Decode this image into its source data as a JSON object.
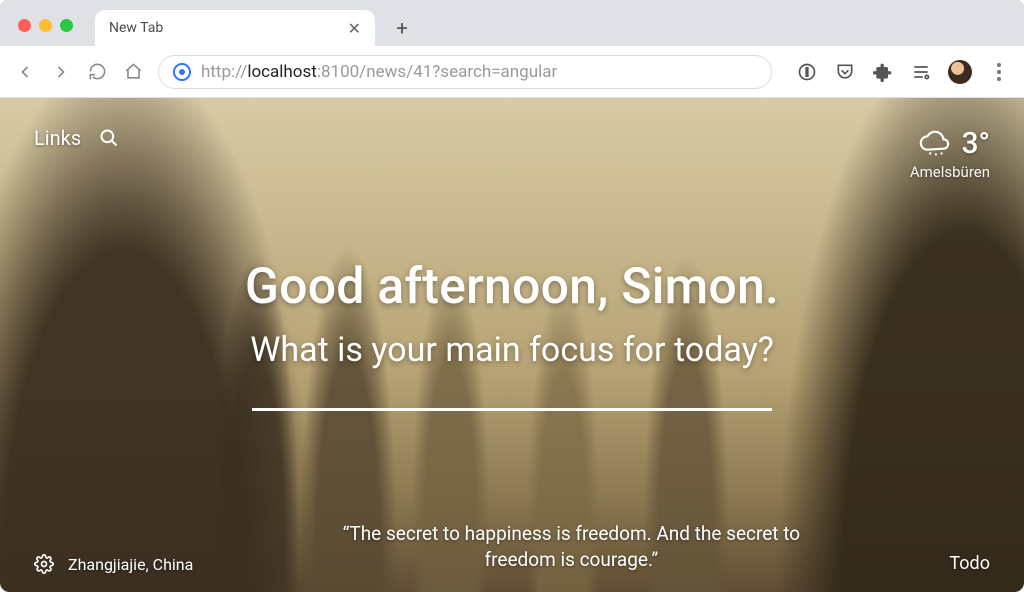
{
  "tab": {
    "title": "New Tab"
  },
  "url": {
    "scheme": "http://",
    "host": "localhost",
    "rest": ":8100/news/41?search=angular"
  },
  "momentum": {
    "links_label": "Links",
    "greeting": "Good afternoon, Simon.",
    "focus_prompt": "What is your main focus for today?",
    "quote": "“The secret to happiness is freedom. And the secret to freedom is courage.”",
    "photo_location": "Zhangjiajie, China",
    "todo_label": "Todo",
    "weather": {
      "temp": "3°",
      "location": "Amelsbüren"
    }
  }
}
